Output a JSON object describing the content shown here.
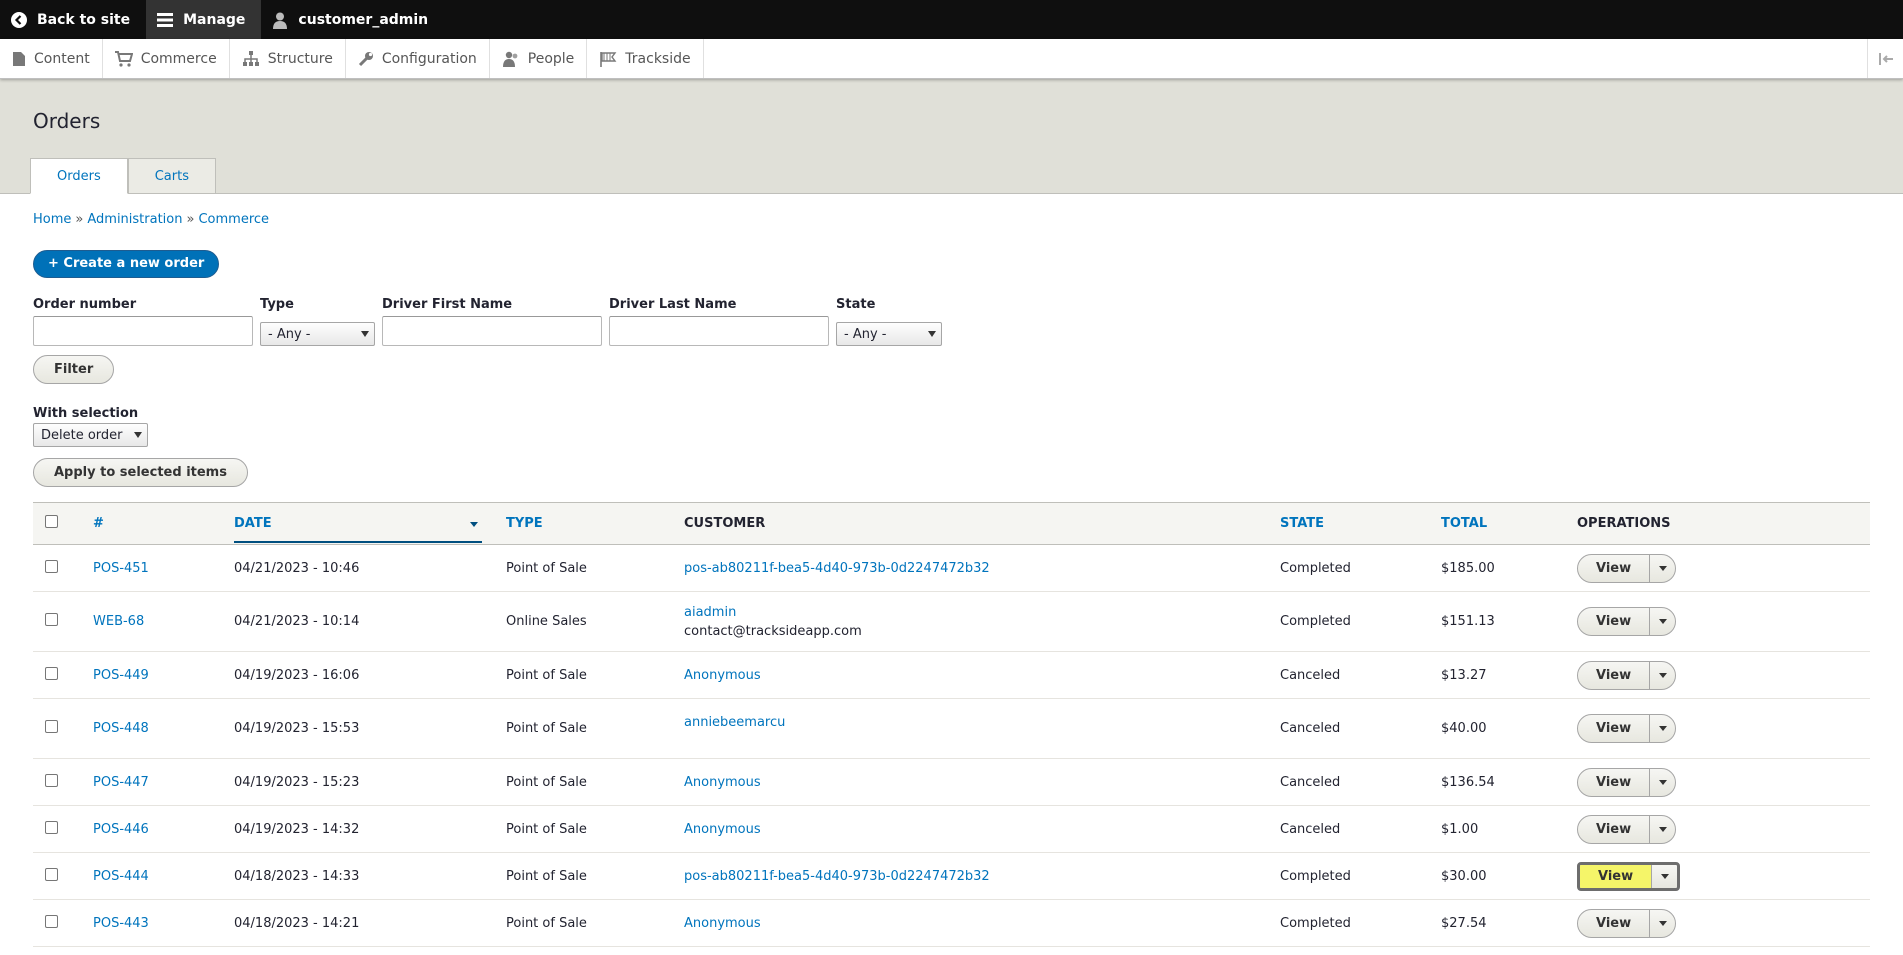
{
  "toolbar": {
    "back_label": "Back to site",
    "manage_label": "Manage",
    "user_label": "customer_admin"
  },
  "tray": {
    "items": [
      {
        "label": "Content",
        "icon": "page-icon"
      },
      {
        "label": "Commerce",
        "icon": "cart-icon"
      },
      {
        "label": "Structure",
        "icon": "hierarchy-icon"
      },
      {
        "label": "Configuration",
        "icon": "wrench-icon"
      },
      {
        "label": "People",
        "icon": "people-icon"
      },
      {
        "label": "Trackside",
        "icon": "flag-icon"
      }
    ]
  },
  "page": {
    "title": "Orders",
    "tabs": [
      {
        "label": "Orders",
        "active": true
      },
      {
        "label": "Carts",
        "active": false
      }
    ],
    "breadcrumb": [
      "Home",
      "Administration",
      "Commerce"
    ],
    "breadcrumb_sep": "»",
    "create_button": "+ Create a new order"
  },
  "filters": {
    "order_number_label": "Order number",
    "order_number_value": "",
    "type_label": "Type",
    "type_value": "- Any -",
    "first_name_label": "Driver First Name",
    "first_name_value": "",
    "last_name_label": "Driver Last Name",
    "last_name_value": "",
    "state_label": "State",
    "state_value": "- Any -",
    "filter_button": "Filter"
  },
  "bulk": {
    "label": "With selection",
    "action_value": "Delete order",
    "apply_button": "Apply to selected items"
  },
  "table": {
    "headers": {
      "num": "#",
      "date": "DATE",
      "type": "TYPE",
      "customer": "CUSTOMER",
      "state": "STATE",
      "total": "TOTAL",
      "operations": "OPERATIONS"
    },
    "rows": [
      {
        "num": "POS-451",
        "date": "04/21/2023 - 10:46",
        "type": "Point of Sale",
        "customer": "pos-ab80211f-bea5-4d40-973b-0d2247472b32",
        "customer_sub": "",
        "state": "Completed",
        "total": "$185.00",
        "op": "View"
      },
      {
        "num": "WEB-68",
        "date": "04/21/2023 - 10:14",
        "type": "Online Sales",
        "customer": "aiadmin",
        "customer_sub": "contact@tracksideapp.com",
        "state": "Completed",
        "total": "$151.13",
        "op": "View"
      },
      {
        "num": "POS-449",
        "date": "04/19/2023 - 16:06",
        "type": "Point of Sale",
        "customer": "Anonymous",
        "customer_sub": "",
        "state": "Canceled",
        "total": "$13.27",
        "op": "View"
      },
      {
        "num": "POS-448",
        "date": "04/19/2023 - 15:53",
        "type": "Point of Sale",
        "customer": "anniebeemarcu",
        "customer_sub": "",
        "state": "Canceled",
        "total": "$40.00",
        "op": "View"
      },
      {
        "num": "POS-447",
        "date": "04/19/2023 - 15:23",
        "type": "Point of Sale",
        "customer": "Anonymous",
        "customer_sub": "",
        "state": "Canceled",
        "total": "$136.54",
        "op": "View"
      },
      {
        "num": "POS-446",
        "date": "04/19/2023 - 14:32",
        "type": "Point of Sale",
        "customer": "Anonymous",
        "customer_sub": "",
        "state": "Canceled",
        "total": "$1.00",
        "op": "View"
      },
      {
        "num": "POS-444",
        "date": "04/18/2023 - 14:33",
        "type": "Point of Sale",
        "customer": "pos-ab80211f-bea5-4d40-973b-0d2247472b32",
        "customer_sub": "",
        "state": "Completed",
        "total": "$30.00",
        "op": "View"
      },
      {
        "num": "POS-443",
        "date": "04/18/2023 - 14:21",
        "type": "Point of Sale",
        "customer": "Anonymous",
        "customer_sub": "",
        "state": "Completed",
        "total": "$27.54",
        "op": "View"
      }
    ]
  },
  "colors": {
    "link": "#0074bd",
    "primary": "#0071b8",
    "highlight": "#f5f569"
  }
}
